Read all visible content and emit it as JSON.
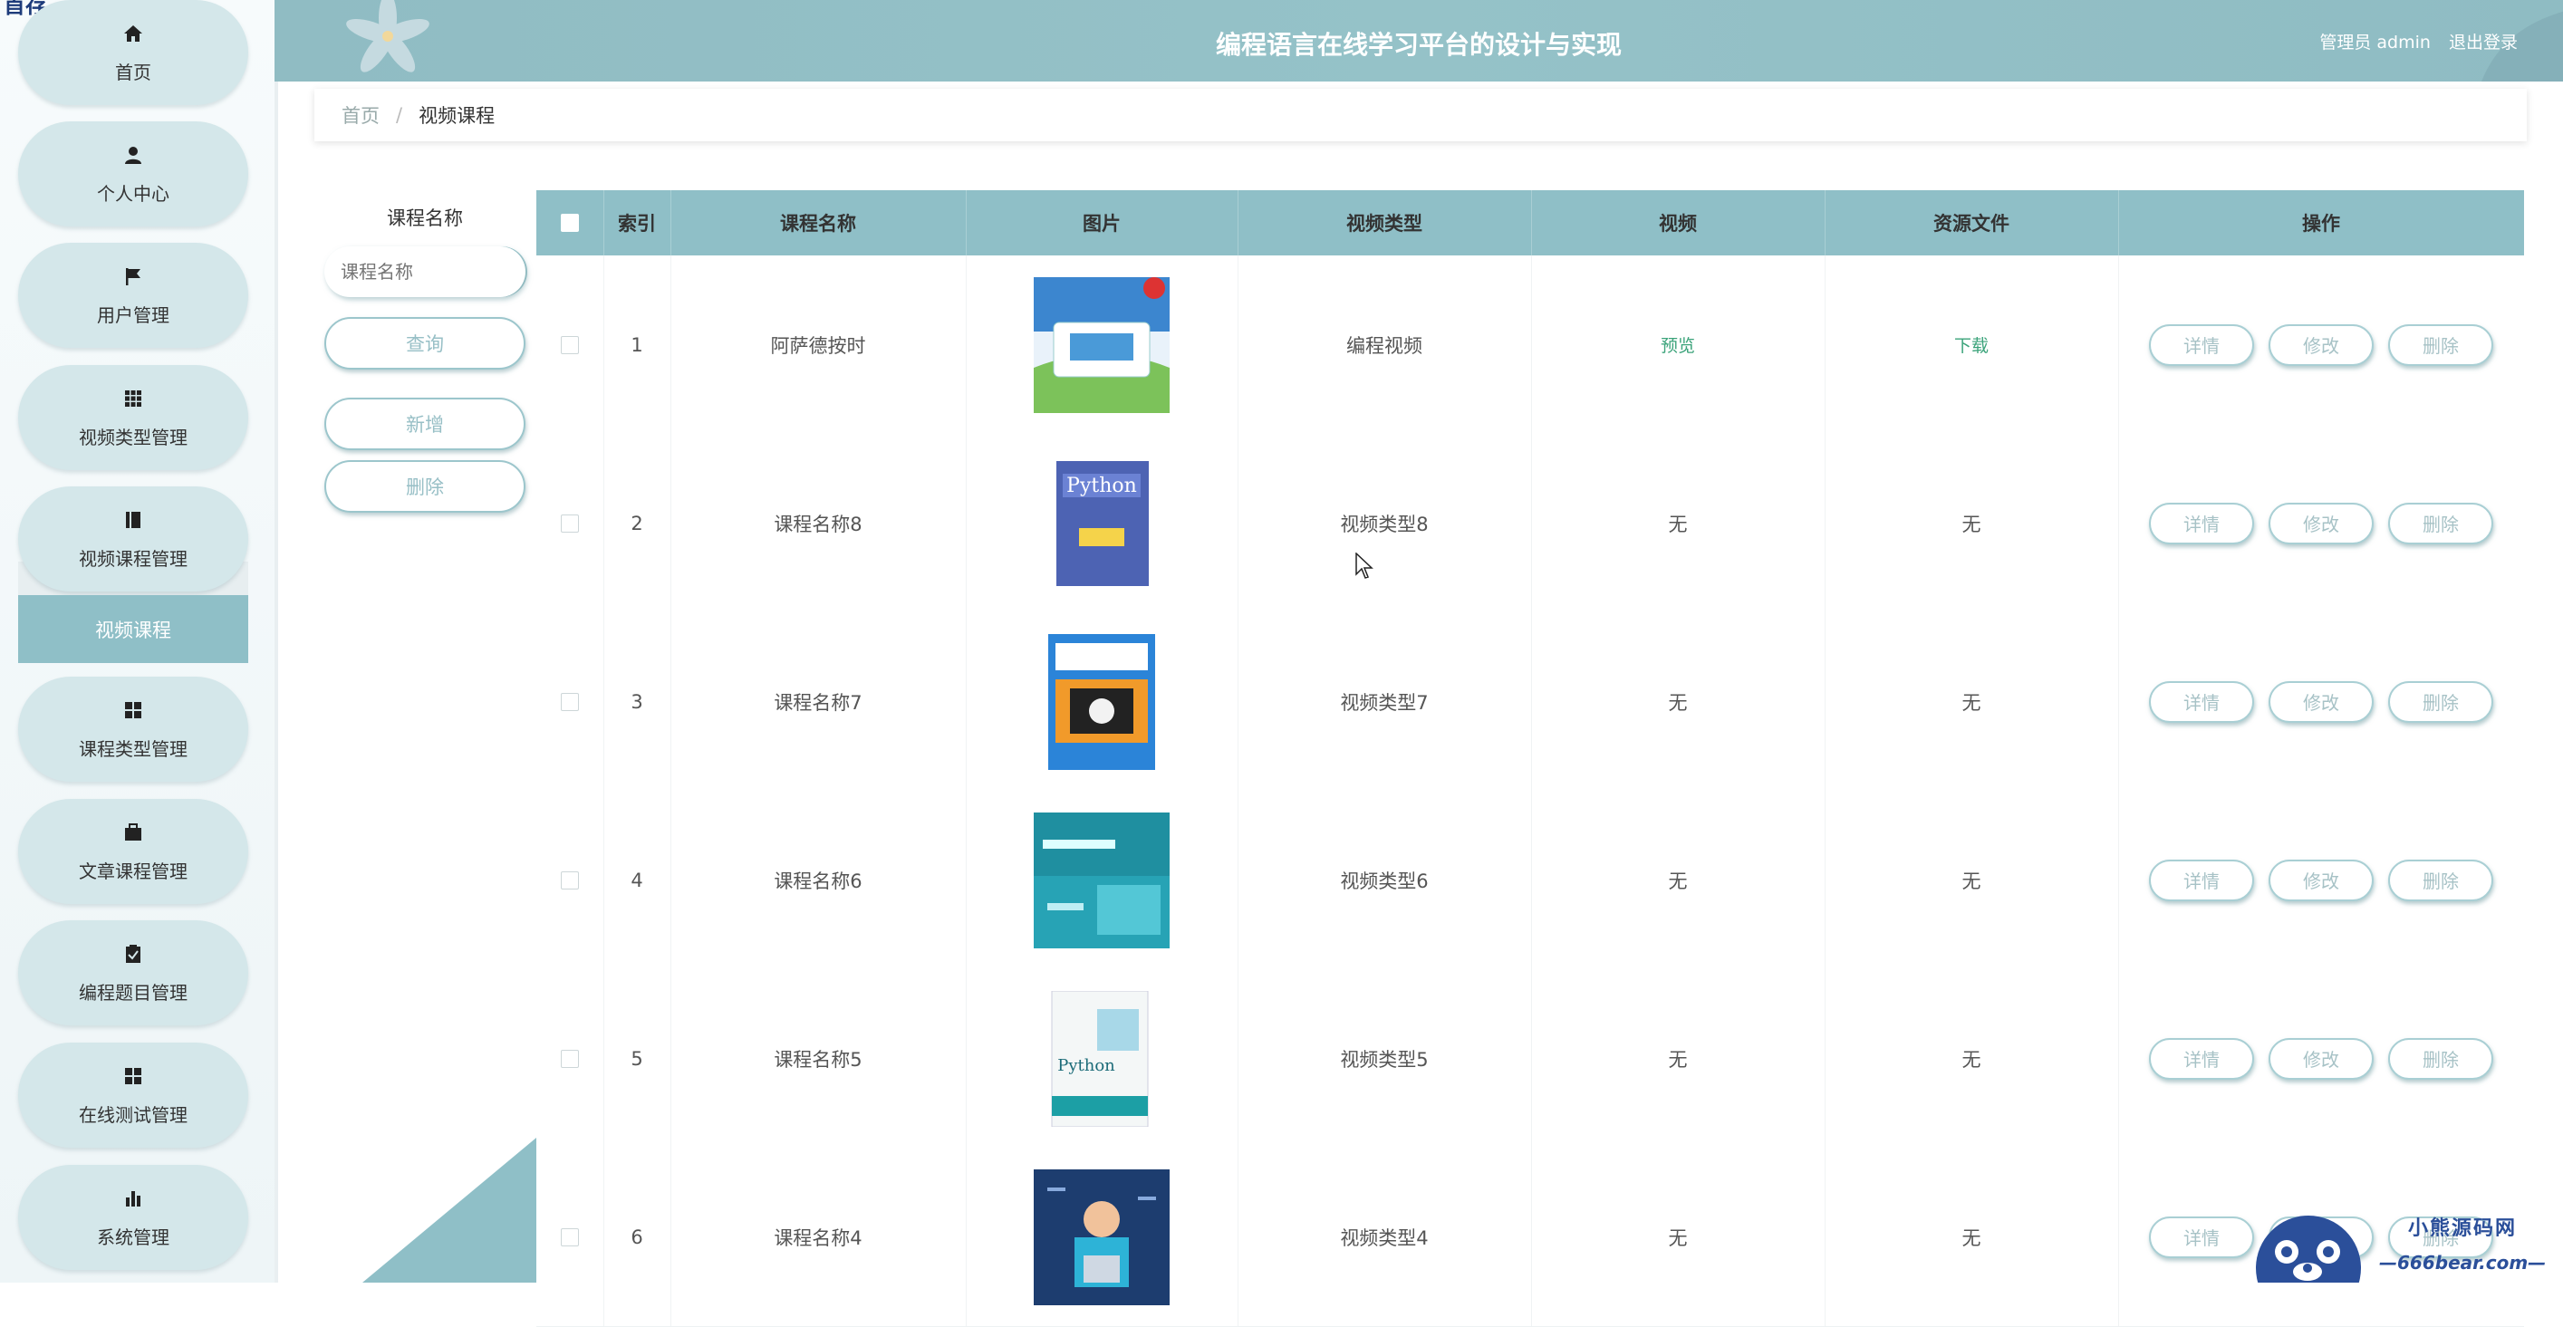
{
  "sidebar": {
    "caption": "首存",
    "items": [
      {
        "label": "首页",
        "icon": "home-icon"
      },
      {
        "label": "个人中心",
        "icon": "user-icon"
      },
      {
        "label": "用户管理",
        "icon": "flag-icon"
      },
      {
        "label": "视频类型管理",
        "icon": "grid-icon"
      },
      {
        "label": "视频课程管理",
        "icon": "book-icon"
      },
      {
        "label": "课程类型管理",
        "icon": "apps-icon"
      },
      {
        "label": "文章课程管理",
        "icon": "briefcase-icon"
      },
      {
        "label": "编程题目管理",
        "icon": "clipboard-icon"
      },
      {
        "label": "在线测试管理",
        "icon": "apps-icon"
      },
      {
        "label": "系统管理",
        "icon": "bar-chart-icon"
      }
    ],
    "active_sub": "视频课程"
  },
  "header": {
    "title": "编程语言在线学习平台的设计与实现",
    "user": "管理员 admin",
    "logout": "退出登录"
  },
  "breadcrumb": {
    "home": "首页",
    "separator": "/",
    "current": "视频课程"
  },
  "search": {
    "label": "课程名称",
    "placeholder": "课程名称",
    "query_button": "查询",
    "add_button": "新增",
    "delete_button": "删除"
  },
  "table": {
    "columns": [
      "索引",
      "课程名称",
      "图片",
      "视频类型",
      "视频",
      "资源文件",
      "操作"
    ],
    "rows": [
      {
        "index": "1",
        "name": "阿萨德按时",
        "type": "编程视频",
        "video": "预览",
        "file": "下载",
        "image": "milk-box"
      },
      {
        "index": "2",
        "name": "课程名称8",
        "type": "视频类型8",
        "video": "无",
        "file": "无",
        "image": "python-book-blue"
      },
      {
        "index": "3",
        "name": "课程名称7",
        "type": "视频类型7",
        "video": "无",
        "file": "无",
        "image": "javascript-book"
      },
      {
        "index": "4",
        "name": "课程名称6",
        "type": "视频类型6",
        "video": "无",
        "file": "无",
        "image": "scratch-book"
      },
      {
        "index": "5",
        "name": "课程名称5",
        "type": "视频类型5",
        "video": "无",
        "file": "无",
        "image": "python-book-white"
      },
      {
        "index": "6",
        "name": "课程名称4",
        "type": "视频类型4",
        "video": "无",
        "file": "无",
        "image": "coder-illustration"
      }
    ],
    "actions": {
      "detail": "详情",
      "edit": "修改",
      "delete": "删除"
    }
  },
  "watermark": {
    "name": "小熊源码网",
    "url": "—666bear.com—"
  },
  "colors": {
    "accent": "#8fbfc7",
    "link": "#3ba37a",
    "menu_bg": "#d4e7ea"
  }
}
